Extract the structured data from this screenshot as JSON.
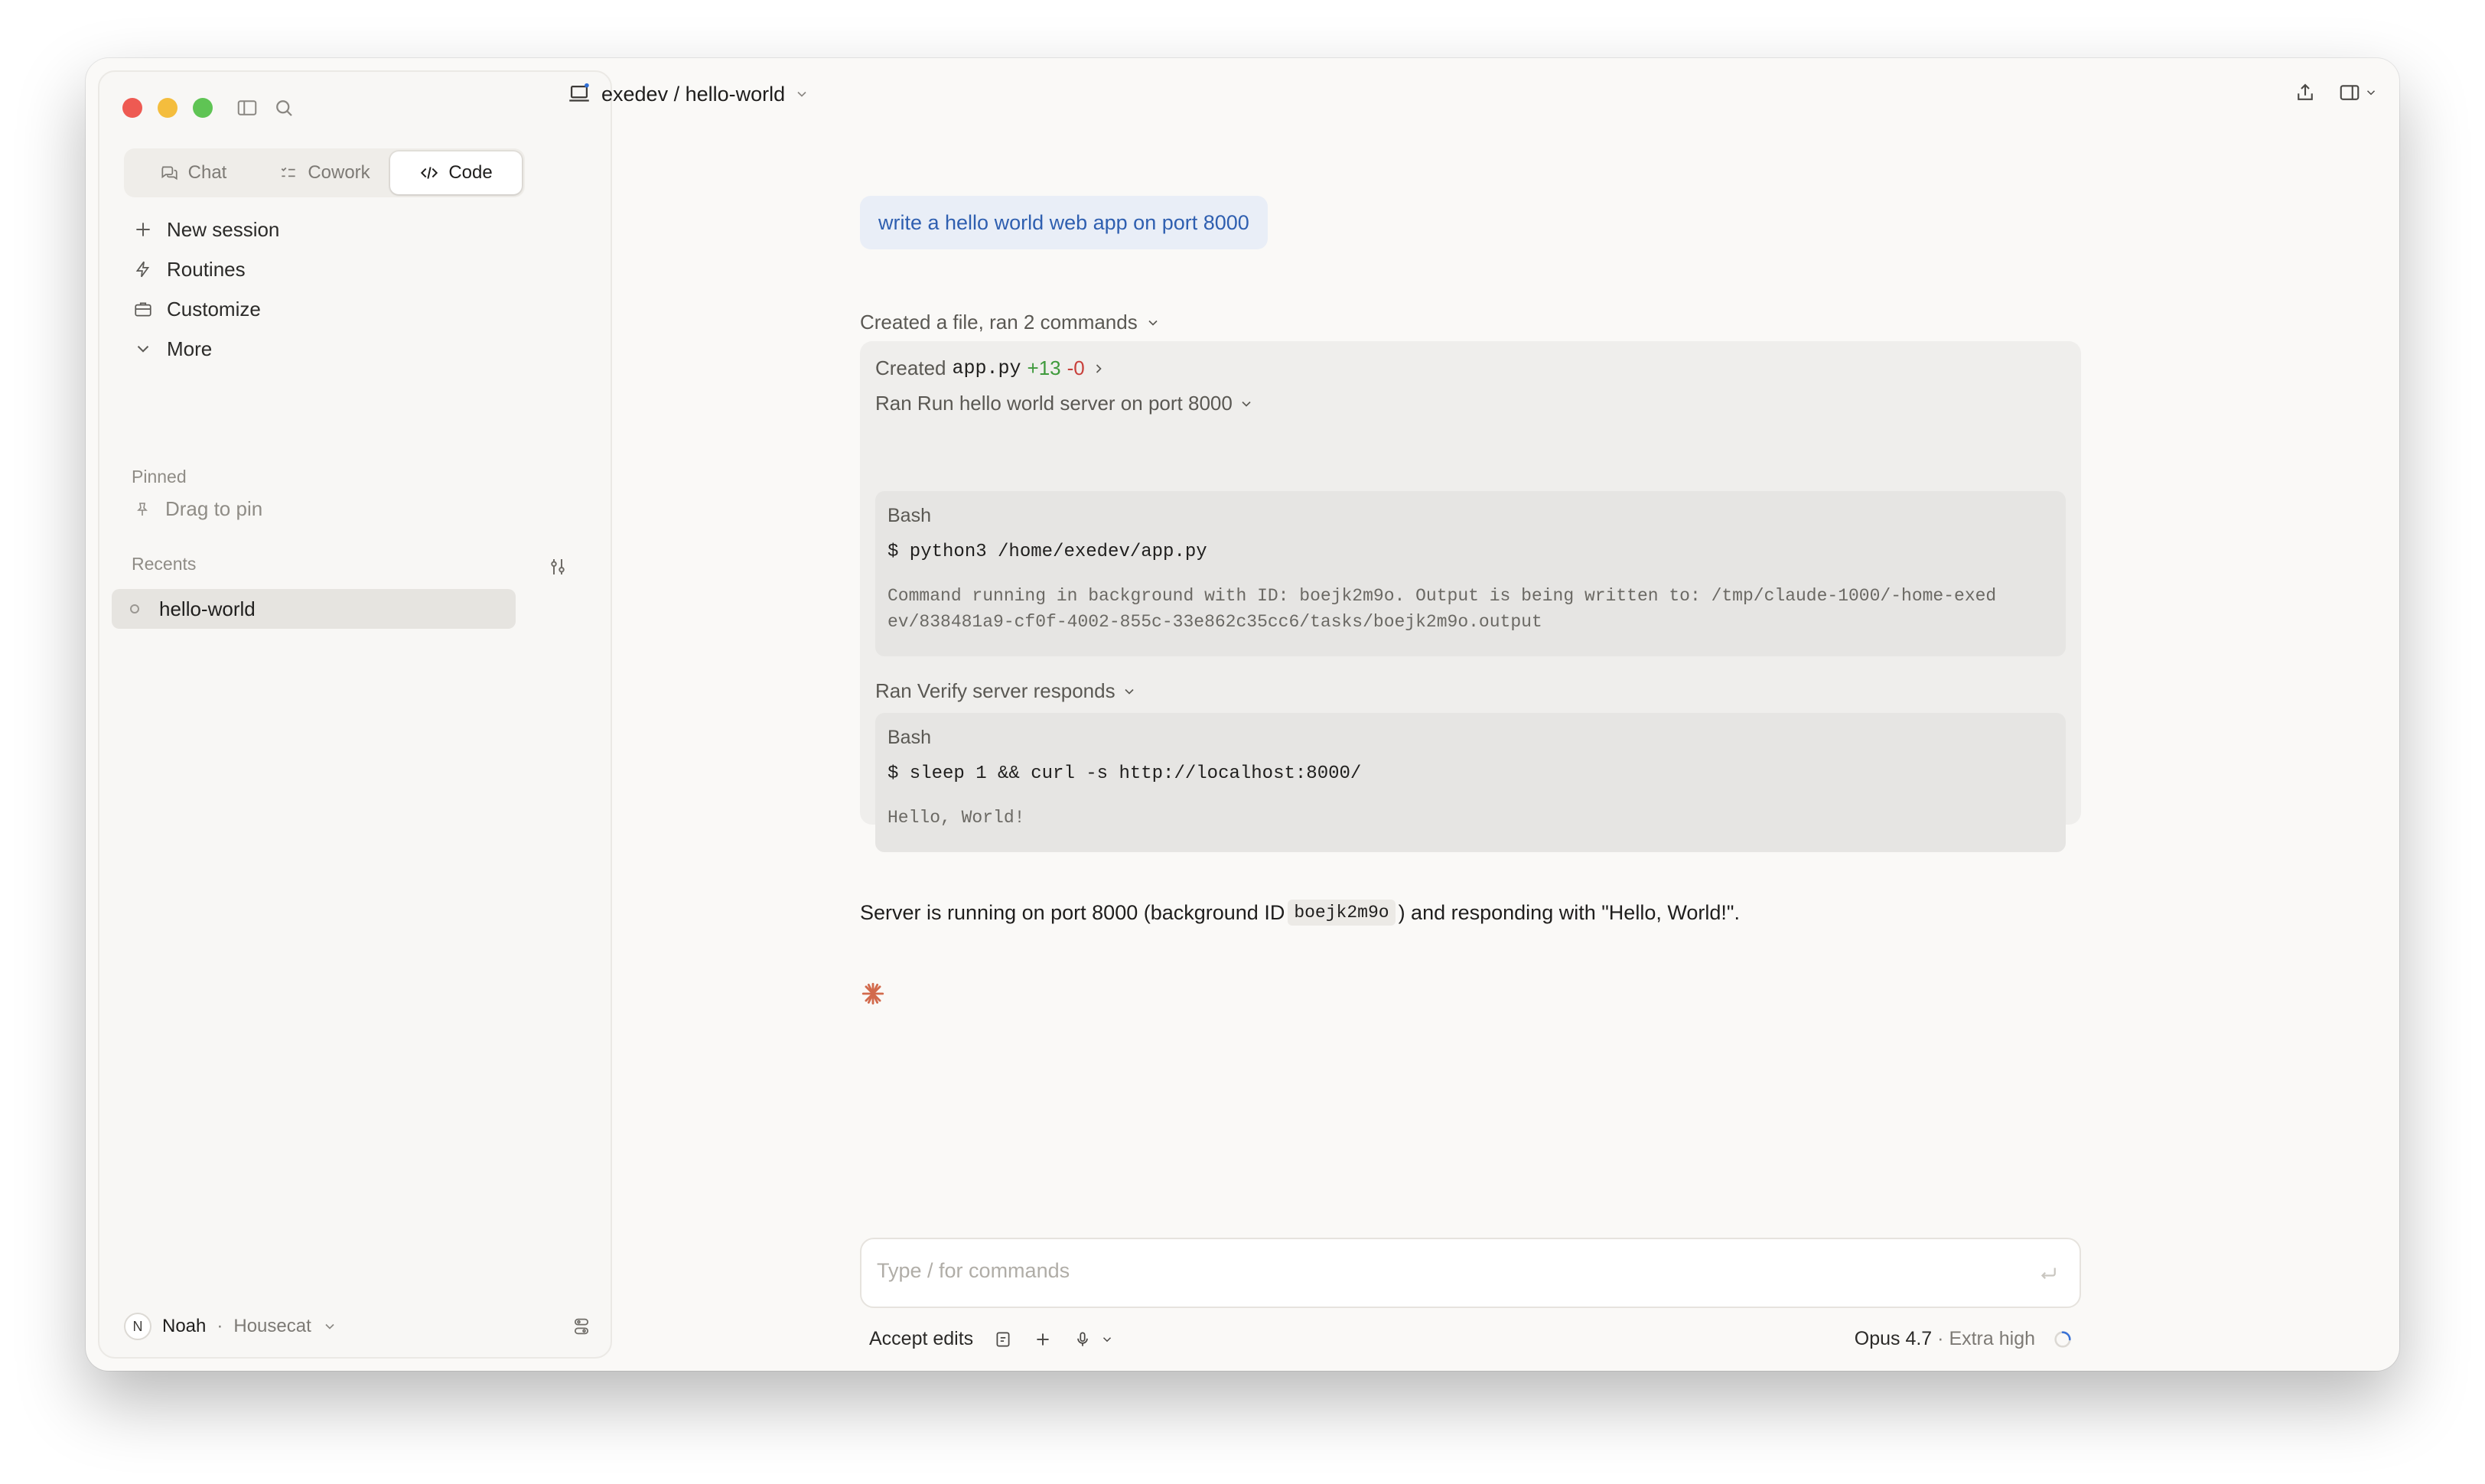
{
  "sidebar": {
    "modes": [
      {
        "label": "Chat",
        "icon": "chat-bubbles-icon",
        "active": false
      },
      {
        "label": "Cowork",
        "icon": "checklist-icon",
        "active": false
      },
      {
        "label": "Code",
        "icon": "code-brackets-icon",
        "active": true
      }
    ],
    "nav": [
      {
        "label": "New session",
        "icon": "plus-icon"
      },
      {
        "label": "Routines",
        "icon": "lightning-icon"
      },
      {
        "label": "Customize",
        "icon": "briefcase-icon"
      },
      {
        "label": "More",
        "icon": "chevron-down-icon"
      }
    ],
    "pinned_label": "Pinned",
    "pinned_hint": "Drag to pin",
    "recents_label": "Recents",
    "recents": [
      {
        "label": "hello-world"
      }
    ],
    "user": {
      "initial": "N",
      "name": "Noah",
      "separator": "·",
      "org": "Housecat"
    }
  },
  "header": {
    "path": "exedev / hello-world"
  },
  "conversation": {
    "user_message": "write a hello world web app on port 8000",
    "tool_summary": "Created a file, ran 2 commands",
    "created": {
      "prefix": "Created",
      "file": "app.py",
      "additions": "+13",
      "deletions": "-0"
    },
    "run1": {
      "label": "Ran Run hello world server on port 8000",
      "tool": "Bash",
      "command": "$ python3 /home/exedev/app.py",
      "output_line1": "Command running in background with ID: boejk2m9o. Output is being written to: /tmp/claude-1000/-home-exed",
      "output_line2": "ev/838481a9-cf0f-4002-855c-33e862c35cc6/tasks/boejk2m9o.output"
    },
    "run2": {
      "label": "Ran Verify server responds",
      "tool": "Bash",
      "command": "$ sleep 1 && curl -s http://localhost:8000/",
      "output": "Hello, World!"
    },
    "answer": {
      "before": "Server is running on port 8000 (background ID",
      "code": "boejk2m9o",
      "after": ") and responding with \"Hello, World!\"."
    }
  },
  "composer": {
    "placeholder": "Type / for commands",
    "value": "",
    "accept_edits": "Accept edits",
    "model": "Opus 4.7",
    "model_separator": "·",
    "effort": "Extra high"
  },
  "colors": {
    "accent_blue": "#2f5fb0",
    "add_green": "#3f9a3c",
    "del_red": "#c8403b",
    "spark": "#d26a4c"
  }
}
